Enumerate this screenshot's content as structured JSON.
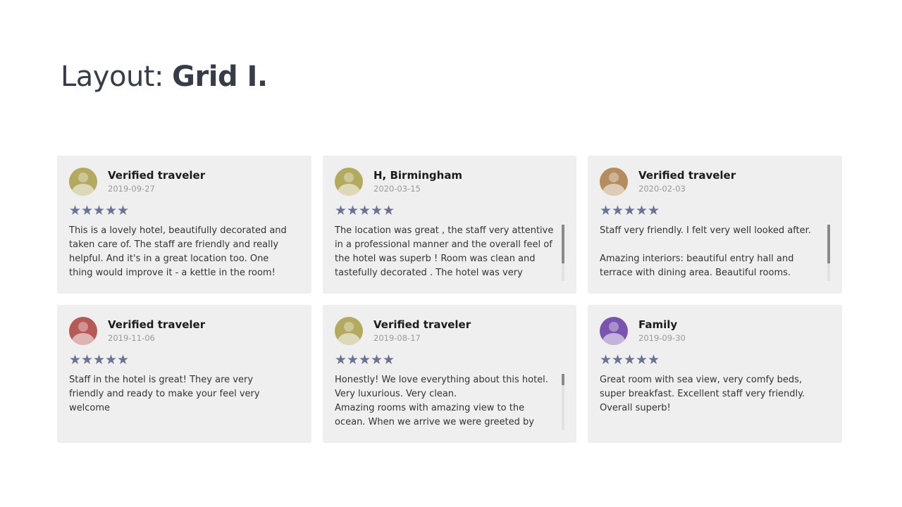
{
  "page": {
    "title_prefix": "Layout:",
    "title_strong": "Grid I."
  },
  "colors": {
    "background": "#ffffff",
    "card": "#efefef",
    "title": "#363c48",
    "star": "#6b7395"
  },
  "reviews": [
    {
      "author": "Verified traveler",
      "date": "2019-09-27",
      "rating": 5,
      "avatar_color": "#b3a95f",
      "text": "This is a lovely hotel, beautifully decorated and taken care of. The staff are friendly and really helpful. And it's in a great location too. One thing would improve it - a kettle in the room!",
      "scrollbar": false
    },
    {
      "author": "H, Birmingham",
      "date": "2020-03-15",
      "rating": 5,
      "avatar_color": "#b3a95f",
      "text": "The location was great , the staff very attentive in a professional manner and the overall feel of the hotel was superb ! Room was clean and tastefully decorated . The hotel was very",
      "scrollbar": true
    },
    {
      "author": "Verified traveler",
      "date": "2020-02-03",
      "rating": 5,
      "avatar_color": "#b48c5e",
      "text": "Staff very friendly. I felt very well looked after.\n\nAmazing interiors: beautiful entry hall and terrace with dining area. Beautiful rooms.",
      "scrollbar": true
    },
    {
      "author": "Verified traveler",
      "date": "2019-11-06",
      "rating": 5,
      "avatar_color": "#b55a57",
      "text": "Staff in the hotel is great! They are very friendly and ready to make your feel very welcome",
      "scrollbar": false
    },
    {
      "author": "Verified traveler",
      "date": "2019-08-17",
      "rating": 5,
      "avatar_color": "#b3a95f",
      "text": "Honestly! We love everything about this hotel. Very luxurious. Very clean.\nAmazing rooms with amazing view to the ocean. When we arrive we were greeted by",
      "scrollbar": true
    },
    {
      "author": "Family",
      "date": "2019-09-30",
      "rating": 5,
      "avatar_color": "#7a55b0",
      "text": "Great room with sea view, very comfy beds, super breakfast. Excellent staff very friendly. Overall superb!",
      "scrollbar": false
    }
  ]
}
